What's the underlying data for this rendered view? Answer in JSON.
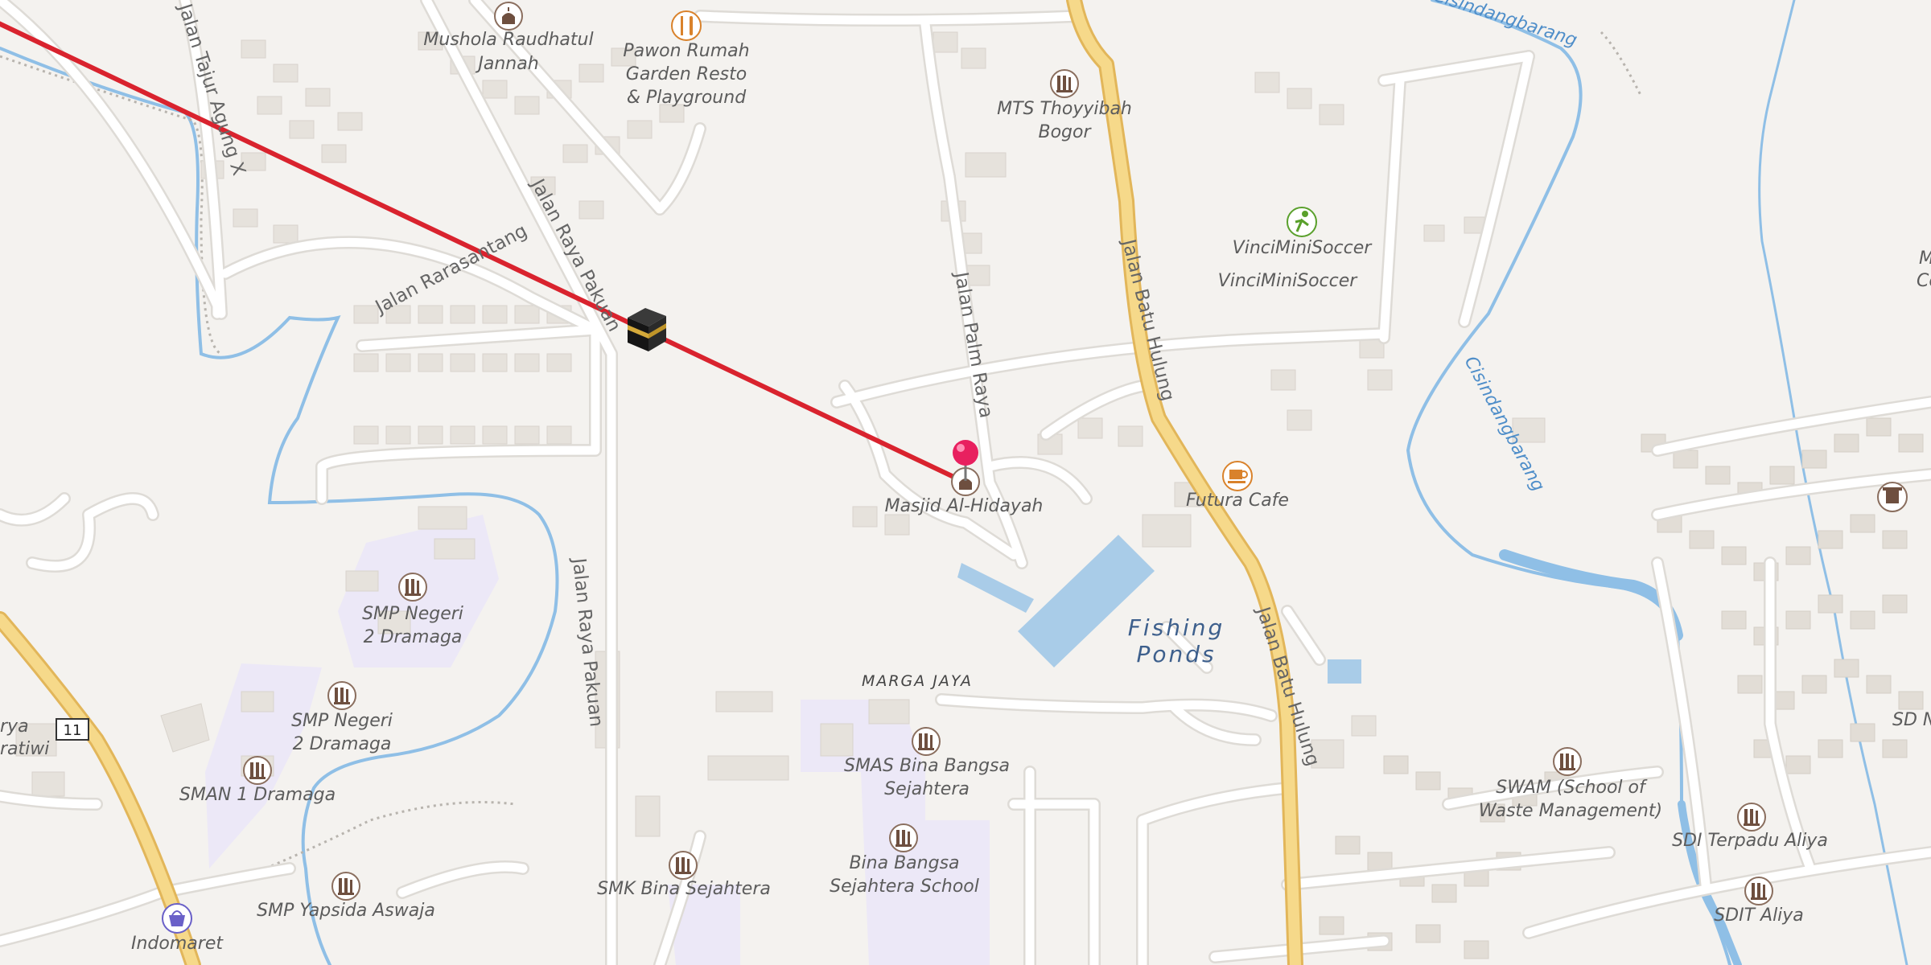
{
  "map": {
    "colors": {
      "background": "#f4f2ef",
      "road": "#ffffff",
      "road_casing": "#dedbd6",
      "main_road": "#f6d98a",
      "main_road_casing": "#e2b65a",
      "water": "#a9cce8",
      "river": "#8fbfe6",
      "building": "#e8e4de",
      "school_area": "#ece8f7",
      "qibla_line": "#d9232e",
      "poi_brown": "#7a5b4a",
      "poi_orange": "#d9822b",
      "poi_green": "#5aa02c",
      "pin": "#e8205f"
    },
    "roads": [
      {
        "name": "Jalan Tajur Agung X"
      },
      {
        "name": "Jalan Rarasantang"
      },
      {
        "name": "Jalan Raya Pakuan"
      },
      {
        "name": "Jalan Raya Pakuan"
      },
      {
        "name": "Jalan Palm Raya"
      },
      {
        "name": "Jalan Batu Hulung"
      },
      {
        "name": "Jalan Batu Hulung"
      }
    ],
    "rivers": [
      {
        "name": "Cisindangbarang"
      },
      {
        "name": "Cisindangbarang"
      }
    ],
    "water_area": {
      "name": "Fishing Ponds",
      "line1": "Fishing",
      "line2": "Ponds"
    },
    "locality": {
      "name": "MARGA JAYA"
    },
    "route_shield": {
      "number": "11"
    },
    "pois": [
      {
        "line1": "Mushola Raudhatul",
        "line2": "Jannah",
        "icon": "mosque-icon"
      },
      {
        "line1": "Pawon Rumah",
        "line2": "Garden Resto",
        "line3": "& Playground",
        "icon": "restaurant-icon"
      },
      {
        "line1": "MTS Thoyyibah",
        "line2": "Bogor",
        "icon": "school-icon"
      },
      {
        "line1": "VinciMiniSoccer",
        "icon": "soccer-icon"
      },
      {
        "line1": "VinciMiniSoccer",
        "icon": ""
      },
      {
        "line1": "Masjid Al-Hidayah",
        "icon": "mosque-icon"
      },
      {
        "line1": "Futura Cafe",
        "icon": "cafe-icon"
      },
      {
        "line1": "SMP Negeri",
        "line2": "2 Dramaga",
        "icon": "school-icon"
      },
      {
        "line1": "SMP Negeri",
        "line2": "2 Dramaga",
        "icon": "school-icon"
      },
      {
        "line1": "SMAN 1 Dramaga",
        "icon": "school-icon"
      },
      {
        "line1": "SMAS Bina Bangsa",
        "line2": "Sejahtera",
        "icon": "school-icon"
      },
      {
        "line1": "Bina Bangsa",
        "line2": "Sejahtera School",
        "icon": "school-icon"
      },
      {
        "line1": "SMK Bina Sejahtera",
        "icon": "school-icon"
      },
      {
        "line1": "SMP Yapsida Aswaja",
        "icon": "school-icon"
      },
      {
        "line1": "Indomaret",
        "icon": "shop-icon"
      },
      {
        "line1": "SWAM (School of",
        "line2": "Waste Management)",
        "icon": "school-icon"
      },
      {
        "line1": "SDI Terpadu Aliya",
        "icon": "school-icon"
      },
      {
        "line1": "SDIT Aliya",
        "icon": "school-icon"
      },
      {
        "line1": "SD N",
        "icon": ""
      },
      {
        "line1": "rya",
        "icon": ""
      },
      {
        "line1": "ratiwi",
        "icon": ""
      },
      {
        "line1": "M",
        "icon": ""
      },
      {
        "line1": "Co",
        "icon": ""
      }
    ],
    "qibla_marker": {
      "icon": "kaaba-icon"
    },
    "location_pin": {
      "icon": "map-pin-icon"
    }
  }
}
